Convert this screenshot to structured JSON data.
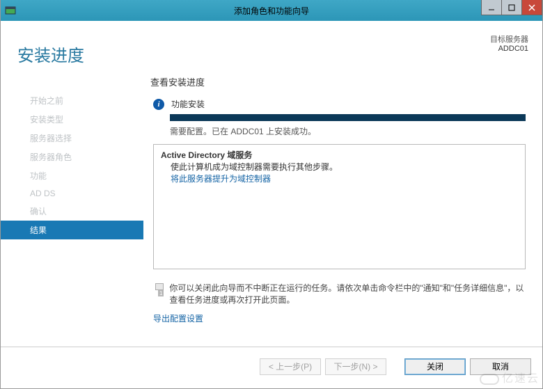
{
  "window": {
    "title": "添加角色和功能向导"
  },
  "header": {
    "heading": "安装进度",
    "target_label": "目标服务器",
    "target_name": "ADDC01"
  },
  "steps": [
    {
      "label": "开始之前",
      "active": false
    },
    {
      "label": "安装类型",
      "active": false
    },
    {
      "label": "服务器选择",
      "active": false
    },
    {
      "label": "服务器角色",
      "active": false
    },
    {
      "label": "功能",
      "active": false
    },
    {
      "label": "AD DS",
      "active": false
    },
    {
      "label": "确认",
      "active": false
    },
    {
      "label": "结果",
      "active": true
    }
  ],
  "main": {
    "section_title": "查看安装进度",
    "status_title": "功能安装",
    "status_sub": "需要配置。已在 ADDC01 上安装成功。",
    "result_heading": "Active Directory 域服务",
    "result_note": "使此计算机成为域控制器需要执行其他步骤。",
    "promote_link": "将此服务器提升为域控制器",
    "close_note": "你可以关闭此向导而不中断正在运行的任务。请依次单击命令栏中的\"通知\"和\"任务详细信息\"，以查看任务进度或再次打开此页面。",
    "export_link": "导出配置设置"
  },
  "footer": {
    "prev": "< 上一步(P)",
    "next": "下一步(N) >",
    "close": "关闭",
    "cancel": "取消"
  },
  "watermark": "亿速云"
}
